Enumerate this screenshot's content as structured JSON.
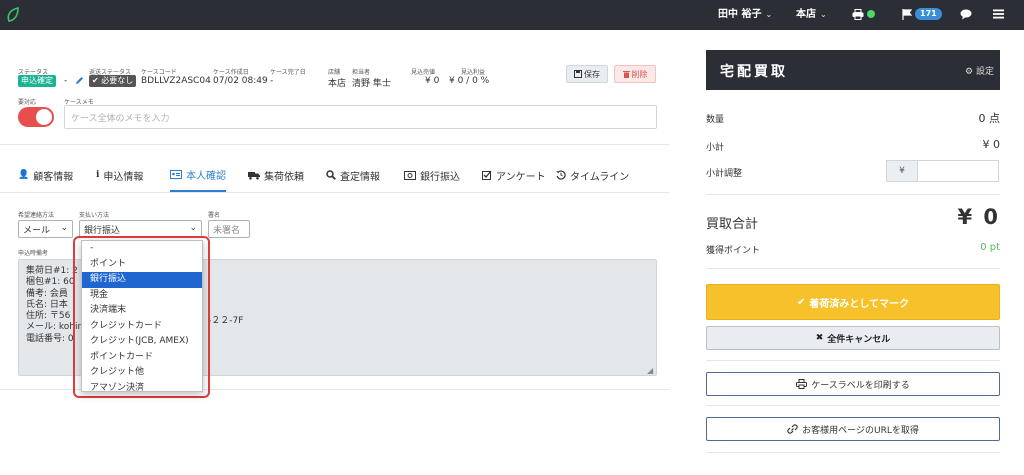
{
  "topbar": {
    "user_name": "田中 裕子",
    "store": "本店",
    "notification_count": "171"
  },
  "case": {
    "status_label": "ステータス",
    "status_value": "申込確定",
    "contact_status_label": "返送ステータス",
    "contact_status_value": "必要なし",
    "case_code_label": "ケースコード",
    "case_code_value": "BDLLVZ2ASC04",
    "created_label": "ケース作成日",
    "created_value": "07/02 08:49",
    "completed_label": "ケース完了日",
    "completed_value": "-",
    "store_label": "店舗",
    "store_value": "本店",
    "staff_label": "担当者",
    "staff_value": "清野 隼士",
    "est_sales_label": "見込売値",
    "est_sales_value": "¥ 0",
    "est_profit_label": "見込利益",
    "est_profit_value": "¥ 0 / 0 %",
    "save_label": "保存",
    "delete_label": "削除",
    "urgent_label": "要対応",
    "memo_label": "ケースメモ",
    "memo_placeholder": "ケース全体のメモを入力"
  },
  "tabs": [
    {
      "label": "顧客情報"
    },
    {
      "label": "申込情報"
    },
    {
      "label": "本人確認"
    },
    {
      "label": "集荷依頼"
    },
    {
      "label": "査定情報"
    },
    {
      "label": "銀行振込"
    },
    {
      "label": "アンケート"
    },
    {
      "label": "タイムライン"
    }
  ],
  "form": {
    "contact_method_label": "希望連絡方法",
    "contact_method_value": "メール",
    "payment_label": "支払い方法",
    "payment_value": "銀行振込",
    "sign_label": "署名",
    "sign_value": "未署名",
    "remarks_label": "申込時備考",
    "remarks_lines": [
      "集荷日#1: 2",
      "梱包#1: 60",
      "備考: 会員",
      "氏名: 日本",
      "住所: 〒56",
      "メール: kohira",
      "電話番号: 0"
    ],
    "remarks_tail": "-２２-7F"
  },
  "dropdown": {
    "options": [
      "-",
      "ポイント",
      "銀行振込",
      "現金",
      "決済端末",
      "クレジットカード",
      "クレジット(JCB, AMEX)",
      "ポイントカード",
      "クレジット他",
      "アマゾン決済"
    ],
    "selected_index": 2
  },
  "panel": {
    "title": "宅配買取",
    "settings_label": "設定",
    "qty_label": "数量",
    "qty_value": "0 点",
    "subtotal_label": "小計",
    "subtotal_value": "¥ 0",
    "adjust_label": "小計調整",
    "adjust_currency": "¥",
    "total_label": "買取合計",
    "total_value": "¥ 0",
    "points_label": "獲得ポイント",
    "points_value": "0 pt",
    "mark_arrived_label": "着荷済みとしてマーク",
    "cancel_all_label": "全件キャンセル",
    "print_label_label": "ケースラベルを印刷する",
    "get_url_label": "お客様用ページのURLを取得"
  },
  "colors": {
    "topbar": "#2b2f35",
    "accent_blue": "#2f7fd1",
    "status_green": "#1ab394",
    "warn_yellow": "#f7c12b",
    "danger_red": "#e23b3b",
    "points_green": "#5cb85c"
  }
}
